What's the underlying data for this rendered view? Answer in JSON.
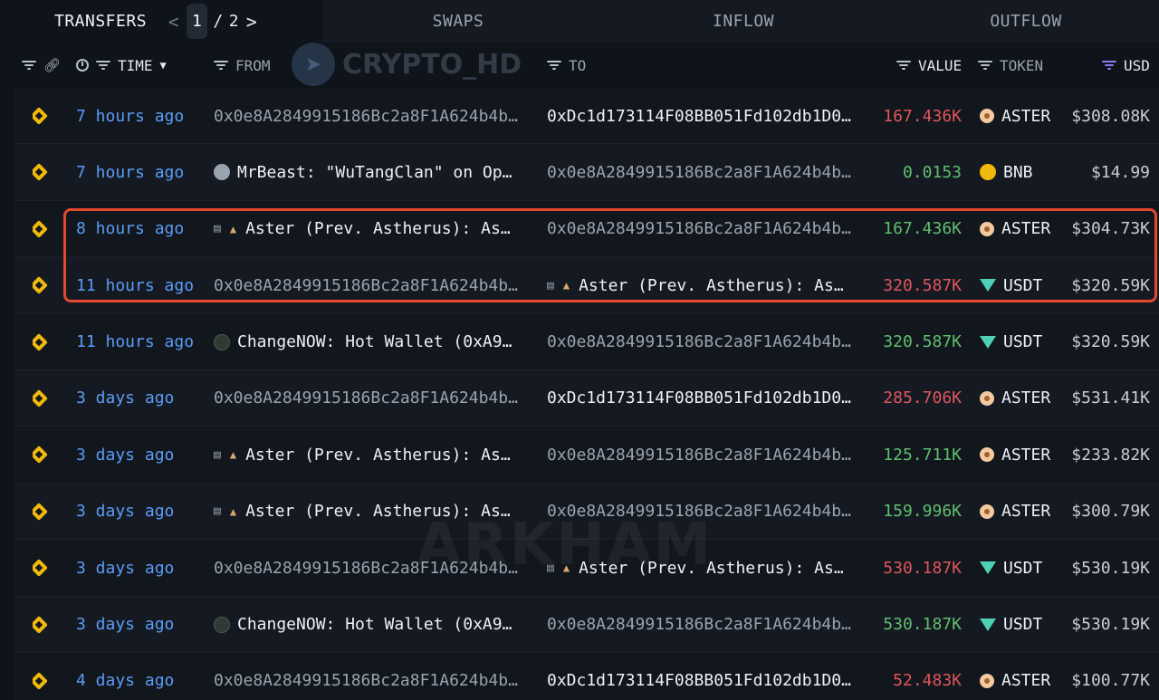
{
  "tabs": {
    "transfers": "TRANSFERS",
    "swaps": "SWAPS",
    "inflow": "INFLOW",
    "outflow": "OUTFLOW",
    "pager": {
      "current": "1",
      "separator": "/",
      "total": "2",
      "prev": "<",
      "next": ">"
    }
  },
  "columns": {
    "time": "TIME",
    "from": "FROM",
    "to": "TO",
    "value": "VALUE",
    "token": "TOKEN",
    "usd": "USD"
  },
  "watermarks": {
    "top": "CRYPTO_HD",
    "middle": "ARKHAM"
  },
  "colors": {
    "time_link": "#5b9cf5",
    "value_negative": "#e0555c",
    "value_positive": "#5fbf6e",
    "highlight_border": "#e2492f"
  },
  "rows": [
    {
      "time": "7 hours ago",
      "from": "0x0e8A2849915186Bc2a8F1A624b4b…",
      "to": "0xDc1d173114F08BB051Fd102db1D0…",
      "value": "167.436K",
      "token": "ASTER",
      "usd": "$308.08K"
    },
    {
      "time": "7 hours ago",
      "from": "MrBeast: \"WuTangClan\" on Op…",
      "to": "0x0e8A2849915186Bc2a8F1A624b4b…",
      "value": "0.0153",
      "token": "BNB",
      "usd": "$14.99"
    },
    {
      "time": "8 hours ago",
      "from": "Aster (Prev. Astherus): As…",
      "to": "0x0e8A2849915186Bc2a8F1A624b4b…",
      "value": "167.436K",
      "token": "ASTER",
      "usd": "$304.73K"
    },
    {
      "time": "11 hours ago",
      "from": "0x0e8A2849915186Bc2a8F1A624b4b…",
      "to": "Aster (Prev. Astherus): As…",
      "value": "320.587K",
      "token": "USDT",
      "usd": "$320.59K"
    },
    {
      "time": "11 hours ago",
      "from": "ChangeNOW: Hot Wallet (0xA9…",
      "to": "0x0e8A2849915186Bc2a8F1A624b4b…",
      "value": "320.587K",
      "token": "USDT",
      "usd": "$320.59K"
    },
    {
      "time": "3 days ago",
      "from": "0x0e8A2849915186Bc2a8F1A624b4b…",
      "to": "0xDc1d173114F08BB051Fd102db1D0…",
      "value": "285.706K",
      "token": "ASTER",
      "usd": "$531.41K"
    },
    {
      "time": "3 days ago",
      "from": "Aster (Prev. Astherus): As…",
      "to": "0x0e8A2849915186Bc2a8F1A624b4b…",
      "value": "125.711K",
      "token": "ASTER",
      "usd": "$233.82K"
    },
    {
      "time": "3 days ago",
      "from": "Aster (Prev. Astherus): As…",
      "to": "0x0e8A2849915186Bc2a8F1A624b4b…",
      "value": "159.996K",
      "token": "ASTER",
      "usd": "$300.79K"
    },
    {
      "time": "3 days ago",
      "from": "0x0e8A2849915186Bc2a8F1A624b4b…",
      "to": "Aster (Prev. Astherus): As…",
      "value": "530.187K",
      "token": "USDT",
      "usd": "$530.19K"
    },
    {
      "time": "3 days ago",
      "from": "ChangeNOW: Hot Wallet (0xA9…",
      "to": "0x0e8A2849915186Bc2a8F1A624b4b…",
      "value": "530.187K",
      "token": "USDT",
      "usd": "$530.19K"
    },
    {
      "time": "4 days ago",
      "from": "0x0e8A2849915186Bc2a8F1A624b4b…",
      "to": "0xDc1d173114F08BB051Fd102db1D0…",
      "value": "52.483K",
      "token": "ASTER",
      "usd": "$100.77K"
    }
  ]
}
